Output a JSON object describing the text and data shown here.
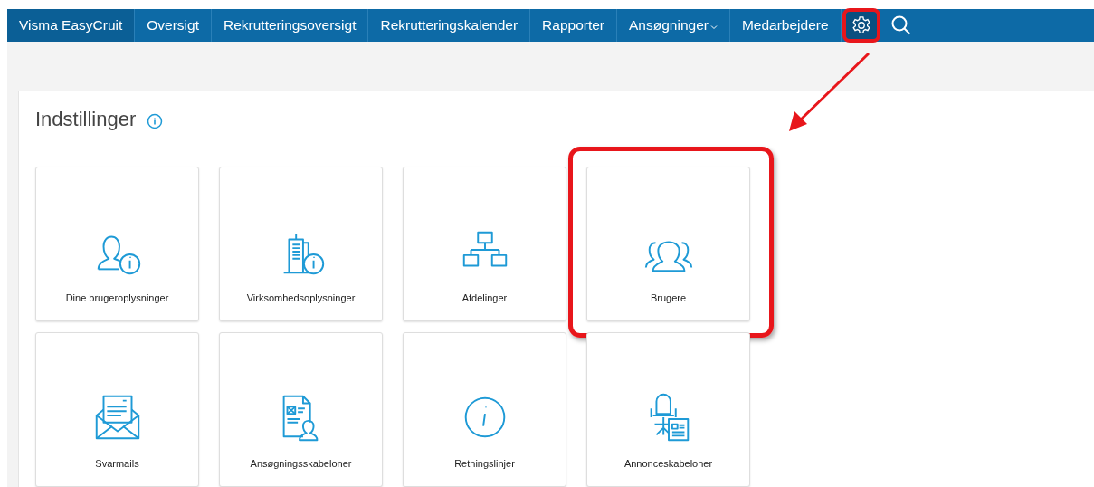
{
  "nav": [
    {
      "kind": "brand",
      "label": "Visma EasyCruit"
    },
    {
      "kind": "link",
      "label": "Oversigt"
    },
    {
      "kind": "link",
      "label": "Rekrutteringsoversigt"
    },
    {
      "kind": "link",
      "label": "Rekrutteringskalender"
    },
    {
      "kind": "link",
      "label": "Rapporter"
    },
    {
      "kind": "dropdown",
      "label": "Ansøgninger"
    },
    {
      "kind": "link",
      "label": "Medarbejdere"
    },
    {
      "kind": "settings",
      "highlighted": true
    },
    {
      "kind": "search",
      "highlighted": false
    }
  ],
  "page": {
    "title": "Indstillinger"
  },
  "tiles": [
    {
      "label": "Dine brugeroplysninger",
      "highlighted": false
    },
    {
      "label": "Virksomhedsoplysninger",
      "highlighted": false
    },
    {
      "label": "Afdelinger",
      "highlighted": false
    },
    {
      "label": "Brugere",
      "highlighted": true
    },
    {
      "label": "Svarmails",
      "highlighted": false
    },
    {
      "label": "Ansøgningsskabeloner",
      "highlighted": false
    },
    {
      "label": "Retningslinjer",
      "highlighted": false
    },
    {
      "label": "Annonceskabeloner",
      "highlighted": false
    }
  ],
  "callout_arrow": true
}
